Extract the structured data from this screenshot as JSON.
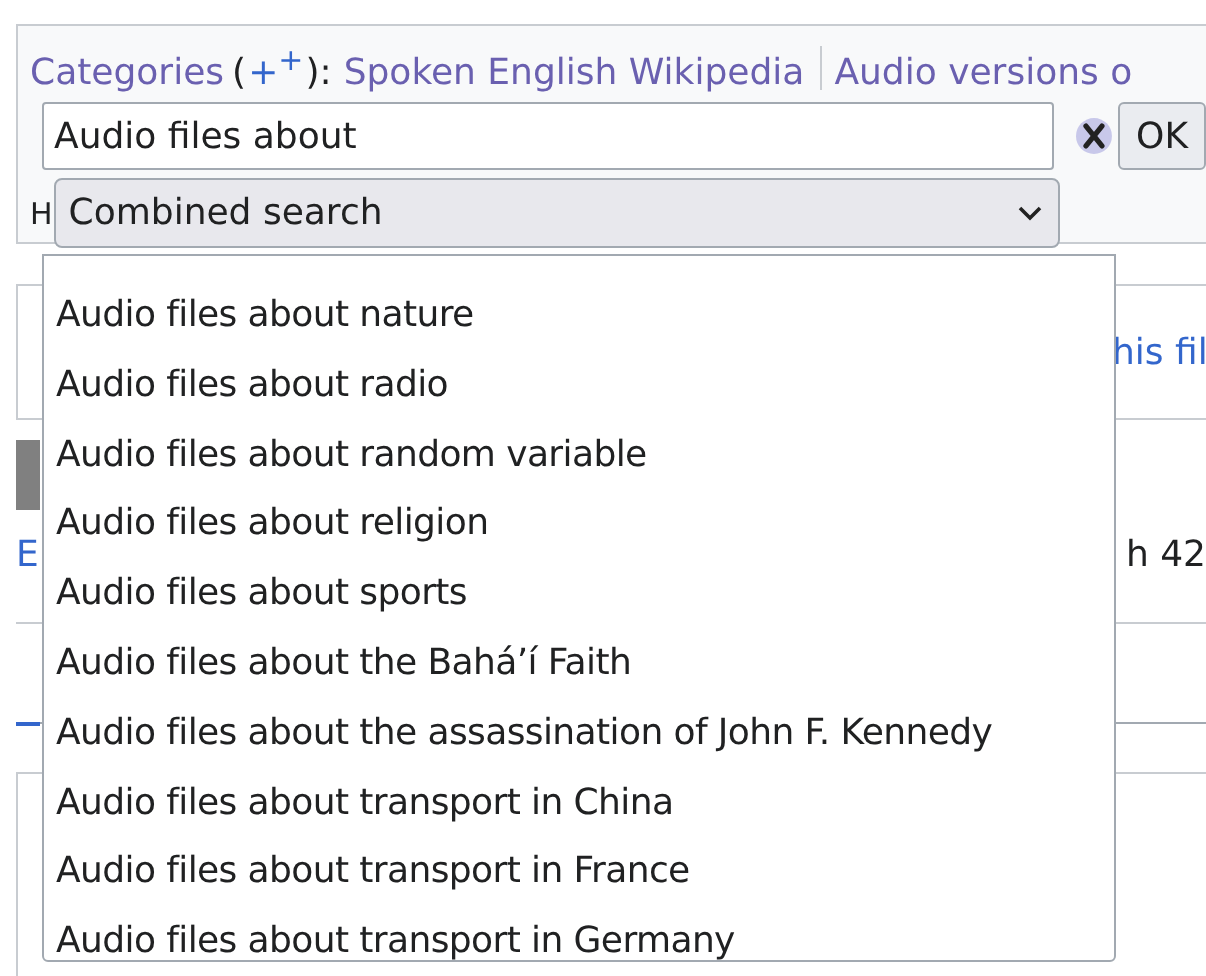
{
  "categories": {
    "label": "Categories",
    "open": "(",
    "add_link": "+$^{+}$",
    "close": "):",
    "links": [
      "Spoken English Wikipedia",
      "Audio versions o"
    ]
  },
  "search": {
    "value": "Audio files about",
    "ok_button": "OK"
  },
  "hint": "H",
  "mode_select": {
    "value": "Combined search"
  },
  "suggestions": [
    "Audio files about nature",
    "Audio files about radio",
    "Audio files about random variable",
    "Audio files about religion",
    "Audio files about sports",
    "Audio files about the Bahá’í Faith",
    "Audio files about the assassination of John F. Kennedy",
    "Audio files about transport in China",
    "Audio files about transport in France",
    "Audio files about transport in Germany"
  ],
  "background": {
    "file_link": "his fil",
    "row_link": "E",
    "row_text": "h 42"
  }
}
